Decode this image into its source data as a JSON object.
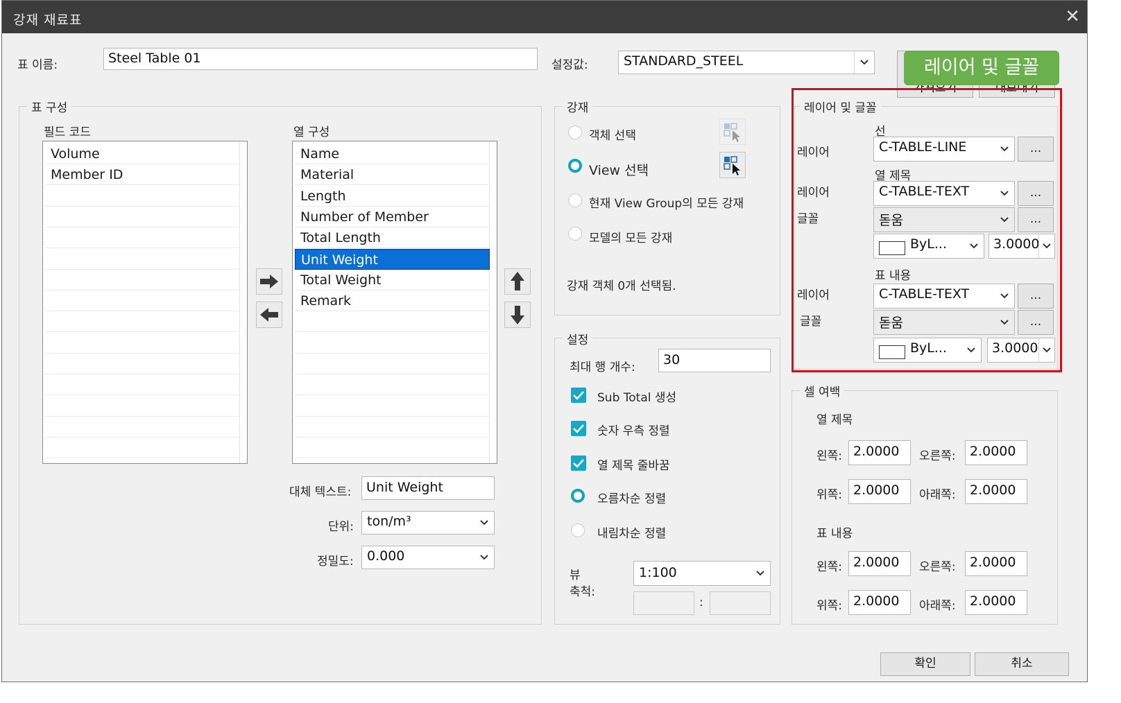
{
  "window": {
    "title": "강재 재료표",
    "close_glyph": "✕"
  },
  "header": {
    "table_name_label": "표 이름:",
    "table_name_value": "Steel Table 01",
    "preset_label": "설정값:",
    "preset_value": "STANDARD_STEEL",
    "btn_load": "가져오기",
    "btn_save": "내보내기"
  },
  "callout": {
    "text": "레이어 및 글꼴",
    "color": "#6ab04c",
    "box_color": "#c8141e"
  },
  "table_config": {
    "title": "표 구성",
    "field_codes_label": "필드 코드",
    "field_codes": [
      "Volume",
      "Member ID"
    ],
    "columns_label": "열 구성",
    "columns": [
      "Name",
      "Material",
      "Length",
      "Number of Member",
      "Total Length",
      "Unit Weight",
      "Total Weight",
      "Remark"
    ],
    "selected_column": "Unit Weight",
    "alt_text_label": "대체 텍스트:",
    "alt_text_value": "Unit Weight",
    "unit_label": "단위:",
    "unit_value": "ton/m³",
    "precision_label": "정밀도:",
    "precision_value": "0.000"
  },
  "steel": {
    "title": "강재",
    "opt_object": "객체 선택",
    "opt_view": "View 선택",
    "opt_group": "현재 View Group의 모든 강재",
    "opt_model": "모델의 모든 강재",
    "selected_option": "View 선택",
    "status": "강재 객체 0개 선택됨."
  },
  "settings": {
    "title": "설정",
    "max_rows_label": "최대 행 개수:",
    "max_rows_value": "30",
    "cb_subtotal": "Sub Total 생성",
    "cb_right_align": "숫자 우측 정렬",
    "cb_wrap": "열 제목 줄바꿈",
    "sort_asc": "오름차순 정렬",
    "sort_desc": "내림차순 정렬",
    "sort_selected": "오름차순 정렬",
    "view_scale_label_1": "뷰",
    "view_scale_label_2": "축척:",
    "view_scale_value": "1:100",
    "ratio_sep": ":"
  },
  "layer_font": {
    "title": "레이어 및 글꼴",
    "line_header": "선",
    "layer_label": "레이어",
    "font_label": "글꼴",
    "line_layer": "C-TABLE-LINE",
    "col_title_header": "열 제목",
    "col_title_layer": "C-TABLE-TEXT",
    "col_title_font": "돋움",
    "col_title_color": "ByL...",
    "col_title_size": "3.0000",
    "content_header": "표 내용",
    "content_layer": "C-TABLE-TEXT",
    "content_font": "돋움",
    "content_color": "ByL...",
    "content_size": "3.0000",
    "more_btn": "..."
  },
  "cell_margin": {
    "title": "셀 여백",
    "col_title_header": "열 제목",
    "content_header": "표 내용",
    "left_label": "왼쪽:",
    "right_label": "오른쪽:",
    "top_label": "위쪽:",
    "bottom_label": "아래쪽:",
    "col_title": {
      "left": "2.0000",
      "right": "2.0000",
      "top": "2.0000",
      "bottom": "2.0000"
    },
    "content": {
      "left": "2.0000",
      "right": "2.0000",
      "top": "2.0000",
      "bottom": "2.0000"
    }
  },
  "footer": {
    "ok": "확인",
    "cancel": "취소"
  }
}
